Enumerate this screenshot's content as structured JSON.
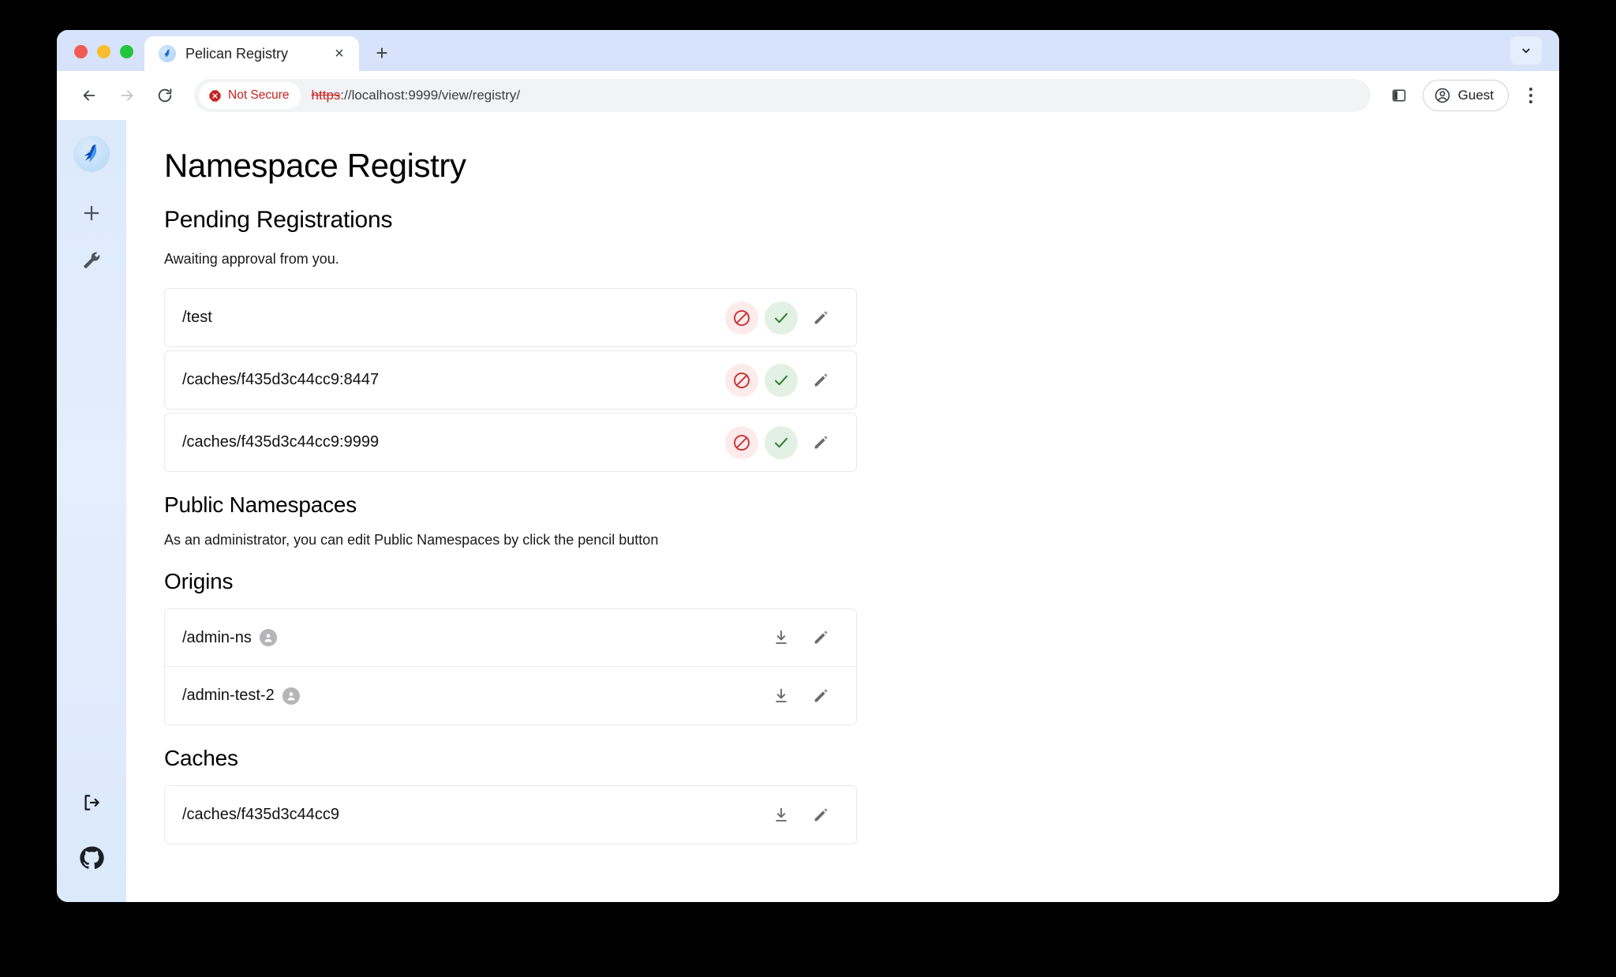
{
  "browser": {
    "tab": {
      "title": "Pelican Registry",
      "favicon": "pelican-icon",
      "close": "×"
    },
    "new_tab_label": "+",
    "tabstrip_chevron": "chevron-down-icon",
    "nav": {
      "back": "←",
      "forward": "→",
      "reload": "⟳"
    },
    "security": {
      "label": "Not Secure",
      "icon": "not-secure-icon"
    },
    "url": {
      "scheme": "https",
      "rest": "://localhost:9999/view/registry/"
    },
    "side_panel": "side-panel-icon",
    "profile": {
      "label": "Guest",
      "icon": "account-circle-icon"
    },
    "menu": "kebab-menu-icon"
  },
  "sidebar": {
    "logo": "pelican-logo",
    "items": [
      {
        "name": "add",
        "icon": "plus-icon"
      },
      {
        "name": "tools",
        "icon": "wrench-icon"
      }
    ],
    "bottom": [
      {
        "name": "logout",
        "icon": "logout-icon"
      },
      {
        "name": "github",
        "icon": "github-icon"
      }
    ]
  },
  "page": {
    "title": "Namespace Registry",
    "pending": {
      "heading": "Pending Registrations",
      "description": "Awaiting approval from you.",
      "rows": [
        {
          "label": "/test"
        },
        {
          "label": "/caches/f435d3c44cc9:8447"
        },
        {
          "label": "/caches/f435d3c44cc9:9999"
        }
      ],
      "actions": {
        "deny": "deny-icon",
        "approve": "approve-icon",
        "edit": "pencil-icon"
      }
    },
    "public": {
      "heading": "Public Namespaces",
      "description": "As an administrator, you can edit Public Namespaces by click the pencil button",
      "origins": {
        "heading": "Origins",
        "rows": [
          {
            "label": "/admin-ns",
            "badge": "person-icon"
          },
          {
            "label": "/admin-test-2",
            "badge": "person-icon"
          }
        ]
      },
      "caches": {
        "heading": "Caches",
        "rows": [
          {
            "label": "/caches/f435d3c44cc9",
            "badge": null
          }
        ]
      },
      "actions": {
        "download": "download-icon",
        "edit": "pencil-icon"
      }
    }
  },
  "colors": {
    "accent": "#1a6fd4",
    "deny": "#c62828",
    "approve": "#2e7d32",
    "sidebar": "#dceafc",
    "not_secure": "#c5221f"
  }
}
